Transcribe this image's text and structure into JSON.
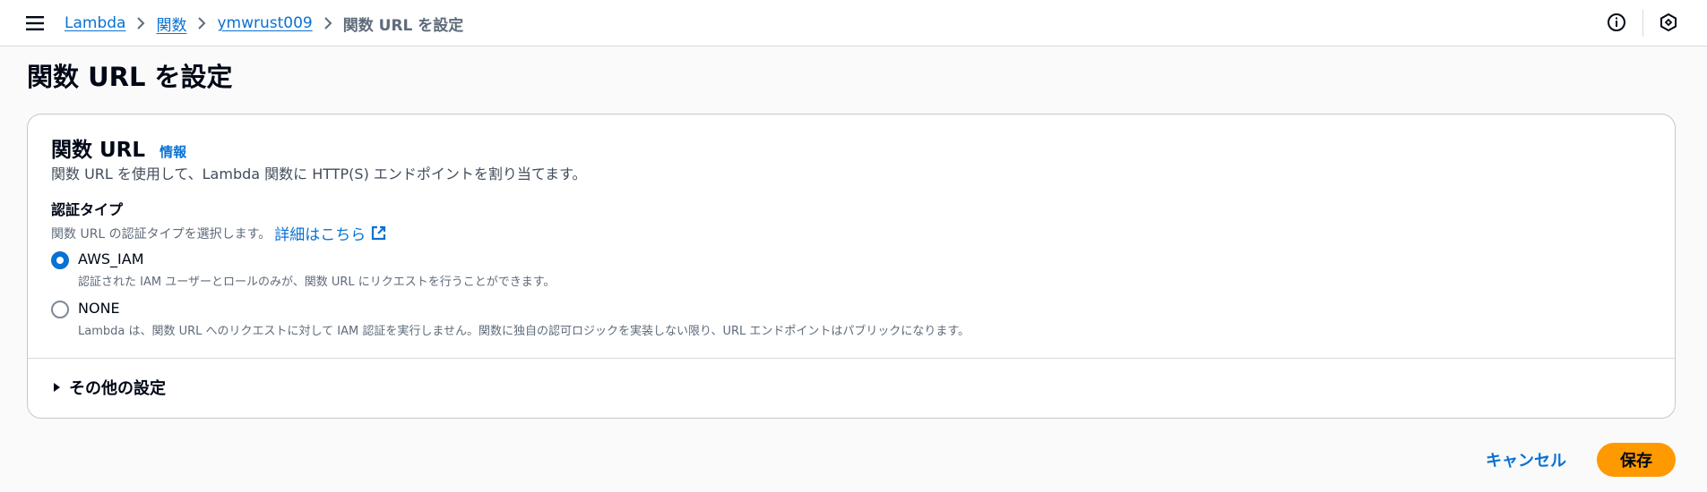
{
  "breadcrumb": {
    "items": [
      "Lambda",
      "関数",
      "ymwrust009"
    ],
    "current": "関数 URL を設定"
  },
  "page": {
    "title": "関数 URL を設定"
  },
  "panel": {
    "title": "関数 URL",
    "info_label": "情報",
    "description": "関数 URL を使用して、Lambda 関数に HTTP(S) エンドポイントを割り当てます。",
    "auth_type": {
      "label": "認証タイプ",
      "description": "関数 URL の認証タイプを選択します。",
      "learn_more": "詳細はこちら",
      "selected": "AWS_IAM",
      "options": [
        {
          "label": "AWS_IAM",
          "description": "認証された IAM ユーザーとロールのみが、関数 URL にリクエストを行うことができます。"
        },
        {
          "label": "NONE",
          "description": "Lambda は、関数 URL へのリクエストに対して IAM 認証を実行しません。関数に独自の認可ロジックを実装しない限り、URL エンドポイントはパブリックになります。"
        }
      ]
    },
    "additional_settings": "その他の設定"
  },
  "actions": {
    "cancel": "キャンセル",
    "save": "保存"
  },
  "icons": {
    "menu": "menu-icon",
    "info": "info-circle-icon",
    "feedback": "feedback-icon",
    "external": "external-link-icon",
    "caret": "caret-right-icon"
  },
  "colors": {
    "link": "#0972d3",
    "primary_button": "#ff9900",
    "text": "#000716",
    "secondary_text": "#5f6b7a"
  }
}
